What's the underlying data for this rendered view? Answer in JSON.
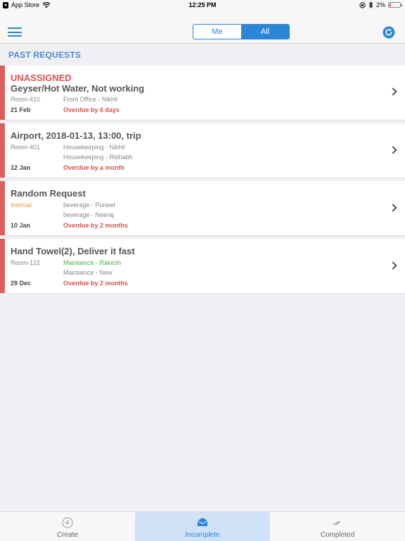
{
  "status_bar": {
    "back_app": "App Store",
    "time": "12:25 PM",
    "battery": "2%"
  },
  "nav": {
    "segments": [
      "Me",
      "All"
    ],
    "selected_segment": "All"
  },
  "section": {
    "title": "PAST REQUESTS"
  },
  "requests": [
    {
      "status": "UNASSIGNED",
      "title": "Geyser/Hot Water, Not working",
      "location": "Room-410",
      "assignments": [
        "Front Office -  Nikhil"
      ],
      "date": "21 Feb",
      "overdue": "Overdue by 6 days"
    },
    {
      "title": "Airport, 2018-01-13, 13:00, trip",
      "location": "Room-401",
      "assignments": [
        "Housekeeping -  Nikhil",
        "Housekeeping -  Rishabh"
      ],
      "date": "12 Jan",
      "overdue": "Overdue by a month"
    },
    {
      "title": "Random Request",
      "location": "Internal",
      "assignments": [
        "beverage -  Puneet",
        "beverage -  Neeraj"
      ],
      "date": "10 Jan",
      "overdue": "Overdue by 2 months"
    },
    {
      "title": "Hand Towel(2), Deliver it fast",
      "location": "Room-122",
      "assignments": [
        "Maintaince -  Rakesh",
        "Maintaince -  New"
      ],
      "date": "29 Dec",
      "overdue": "Overdue by 2 months"
    }
  ],
  "tabs": [
    {
      "label": "Create",
      "icon": "plus-circle-icon"
    },
    {
      "label": "Incomplete",
      "icon": "envelope-icon"
    },
    {
      "label": "Completed",
      "icon": "double-check-icon"
    }
  ],
  "active_tab": "Incomplete",
  "colors": {
    "accent": "#2b86d8",
    "overdue": "#d9534f",
    "card_stripe": "#d9605c",
    "section_title": "#4a8bd2"
  }
}
